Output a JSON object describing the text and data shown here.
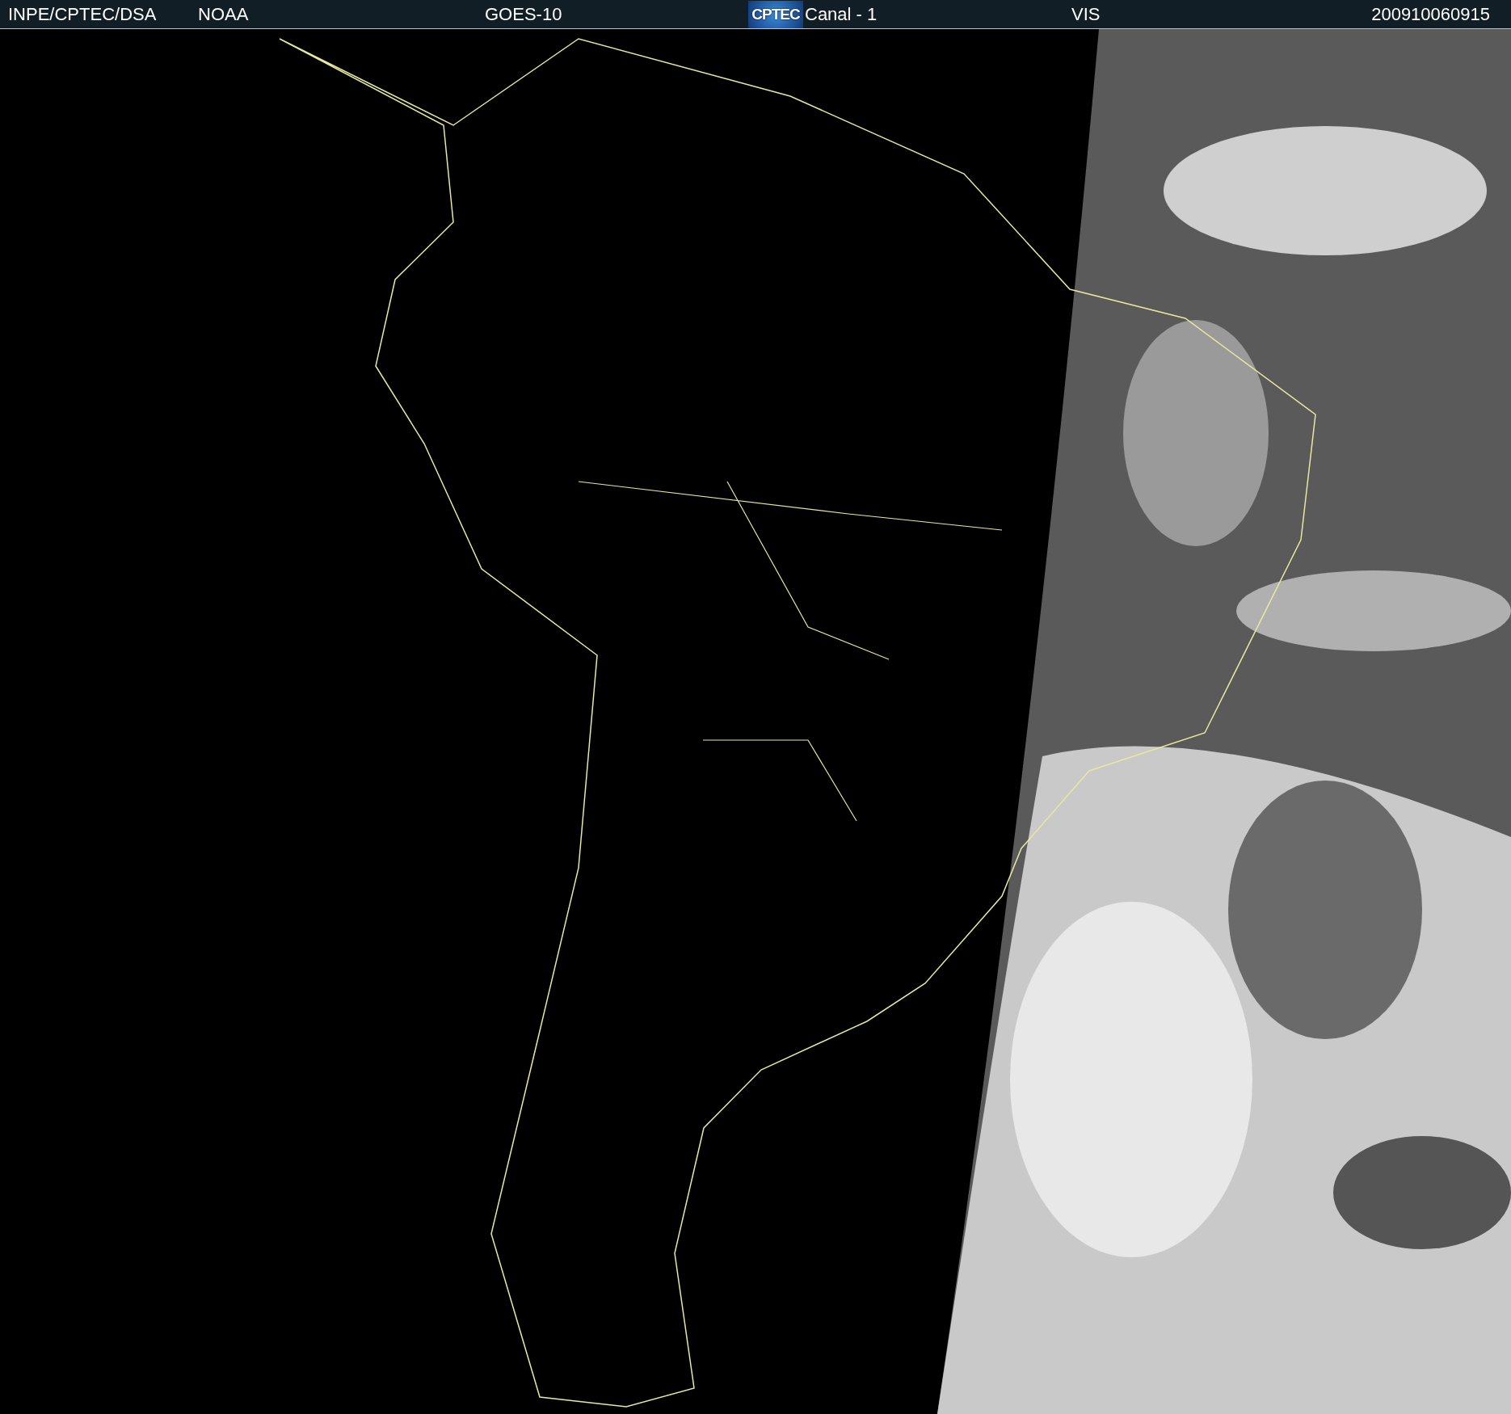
{
  "header": {
    "source": "INPE/CPTEC/DSA",
    "agency": "NOAA",
    "satellite": "GOES-10",
    "logo_text": "CPTEC",
    "channel": "Canal - 1",
    "band": "VIS",
    "timestamp": "200910060915"
  }
}
